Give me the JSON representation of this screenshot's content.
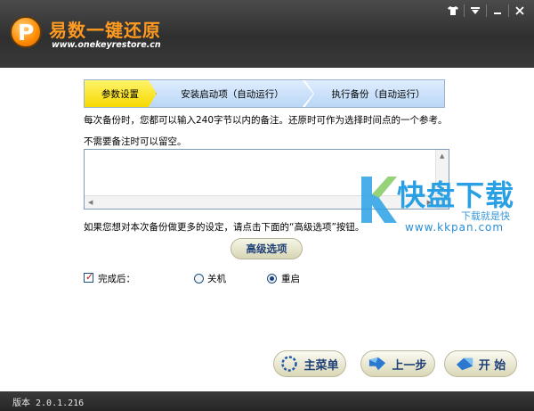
{
  "header": {
    "app_name": "易数一键还原",
    "url": "www.onekeyrestore.cn",
    "window_buttons": [
      "shirt-icon",
      "menu-icon",
      "minimize-icon",
      "close-icon"
    ]
  },
  "steps": [
    {
      "label": "参数设置",
      "active": true
    },
    {
      "label": "安装启动项（自动运行）",
      "active": false
    },
    {
      "label": "执行备份（自动运行）",
      "active": false
    }
  ],
  "main": {
    "info_line": "每次备份时，您都可以输入240字节以内的备注。还原时可作为选择时间点的一个参考。",
    "note_hint": "不需要备注时可以留空。",
    "note_value": "",
    "advanced_hint": "如果您想对本次备份做更多的设定，请点击下面的“高级选项”按钮。",
    "advanced_label": "高级选项",
    "after_label": "完成后：",
    "after_checked": true,
    "shutdown_label": "关机",
    "restart_label": "重启",
    "selected_option": "重启"
  },
  "buttons": {
    "menu": "主菜单",
    "back": "上一步",
    "start": "开 始"
  },
  "watermark": {
    "title": "快盘下载",
    "sub": "下载就是快",
    "url": "www.kkpan.com"
  },
  "status": {
    "version": "版本 2.0.1.216"
  },
  "colors": {
    "titlebar": "#3a3a3a",
    "accent": "#ff9a20",
    "step_active": "#f6d800",
    "step_inactive": "#b8d6f5",
    "button_text": "#1e3f78"
  }
}
